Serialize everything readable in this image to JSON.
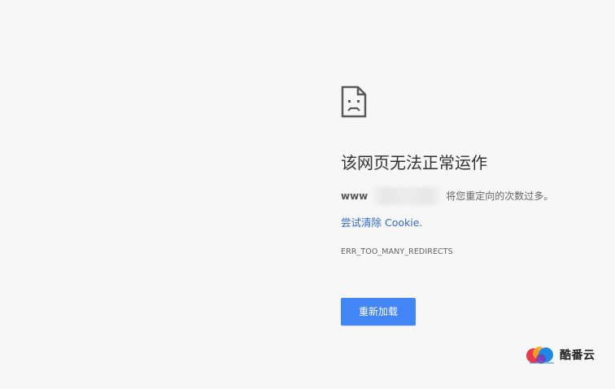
{
  "error_page": {
    "icon": "sad-page-icon",
    "title": "该网页无法正常运作",
    "domain_prefix": "www",
    "message_suffix": "将您重定向的次数过多。",
    "cookie_link": "尝试清除 Cookie.",
    "error_code": "ERR_TOO_MANY_REDIRECTS",
    "reload_label": "重新加载",
    "accent_color": "#4285f4",
    "link_color": "#3368cc"
  },
  "watermark": {
    "icon": "kufan-cloud-logo",
    "text": "酷番云"
  }
}
